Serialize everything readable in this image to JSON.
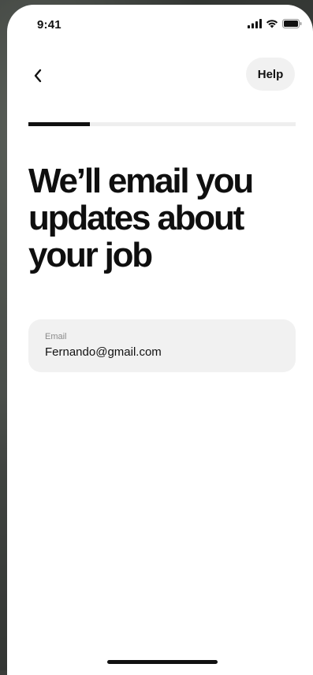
{
  "status_bar": {
    "time": "9:41",
    "icons": [
      "cellular-signal-icon",
      "wifi-icon",
      "battery-icon"
    ]
  },
  "nav": {
    "back_icon": "chevron-left-icon",
    "help_label": "Help"
  },
  "progress": {
    "fraction": 0.23
  },
  "headline": "We’ll email you updates about your job",
  "email": {
    "label": "Email",
    "value": "Fernando@gmail.com"
  },
  "colors": {
    "text": "#111111",
    "field_background": "#f1f1f1",
    "progress_track": "#eeeeee",
    "progress_fill": "#111111"
  }
}
